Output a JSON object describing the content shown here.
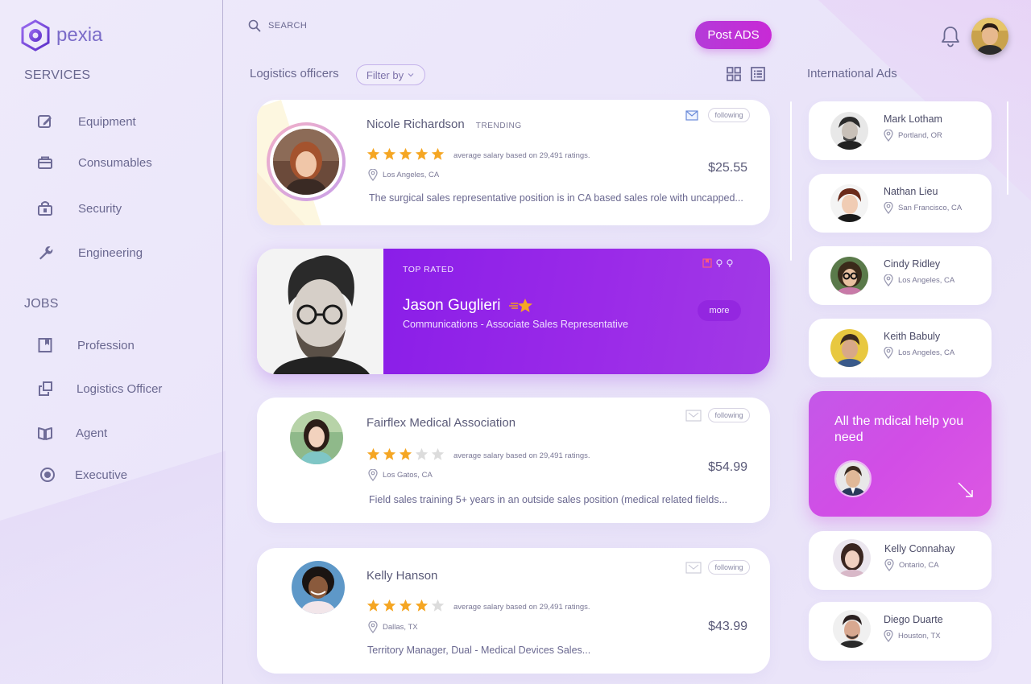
{
  "app": {
    "name": "pexia"
  },
  "sidebar": {
    "services_title": "SERVICES",
    "services": [
      {
        "label": "Equipment",
        "icon": "edit-icon"
      },
      {
        "label": "Consumables",
        "icon": "box-icon"
      },
      {
        "label": "Security",
        "icon": "lock-box-icon"
      },
      {
        "label": "Engineering",
        "icon": "wrench-icon"
      }
    ],
    "jobs_title": "JOBS",
    "jobs": [
      {
        "label": "Profession",
        "icon": "bookmark-icon"
      },
      {
        "label": "Logistics  Officer",
        "icon": "copy-icon"
      },
      {
        "label": "Agent",
        "icon": "book-icon"
      },
      {
        "label": "Executive",
        "icon": "radio-icon"
      }
    ]
  },
  "topbar": {
    "search_placeholder": "SEARCH",
    "post_label": "Post ADS"
  },
  "listing": {
    "title": "Logistics officers",
    "filter_label": "Filter by",
    "cards": [
      {
        "name": "Nicole Richardson",
        "tag": "TRENDING",
        "rating": 5,
        "rating_text": "average salary based on 29,491 ratings.",
        "location": "Los  Angeles, CA",
        "price": "$25.55",
        "description": "The surgical sales representative position is in CA based sales role with uncapped...",
        "follow_label": "following"
      },
      {
        "name": "Fairflex Medical Association",
        "tag": "",
        "rating": 3,
        "rating_text": "average salary based on 29,491 ratings.",
        "location": "Los Gatos, CA",
        "price": "$54.99",
        "description": "Field sales training 5+ years in an outside sales position (medical related fields...",
        "follow_label": "following"
      },
      {
        "name": "Kelly Hanson",
        "tag": "",
        "rating": 4,
        "rating_text": "average salary based on 29,491 ratings.",
        "location": "Dallas, TX",
        "price": "$43.99",
        "description": "Territory Manager, Dual - Medical Devices Sales...",
        "follow_label": "following"
      }
    ],
    "featured": {
      "badge": "TOP RATED",
      "name": "Jason Guglieri",
      "title": "Communications - Associate Sales Representative",
      "more_label": "more"
    }
  },
  "international": {
    "title": "International Ads",
    "people": [
      {
        "name": "Mark Lotham",
        "location": "Portland, OR"
      },
      {
        "name": "Nathan Lieu",
        "location": "San Francisco, CA"
      },
      {
        "name": "Cindy Ridley",
        "location": "Los  Angeles, CA"
      },
      {
        "name": "Keith Babuly",
        "location": "Los  Angeles, CA"
      },
      {
        "name": "Kelly Connahay",
        "location": "Ontario, CA"
      },
      {
        "name": "Diego Duarte",
        "location": "Houston, TX"
      }
    ],
    "promo": {
      "text": "All the mdical help you need"
    }
  },
  "colors": {
    "accent": "#c82ad6",
    "featured": "#8a1ee8",
    "promo": "#d24de6",
    "star": "#f5a623",
    "star_empty": "#dcdcdc"
  }
}
